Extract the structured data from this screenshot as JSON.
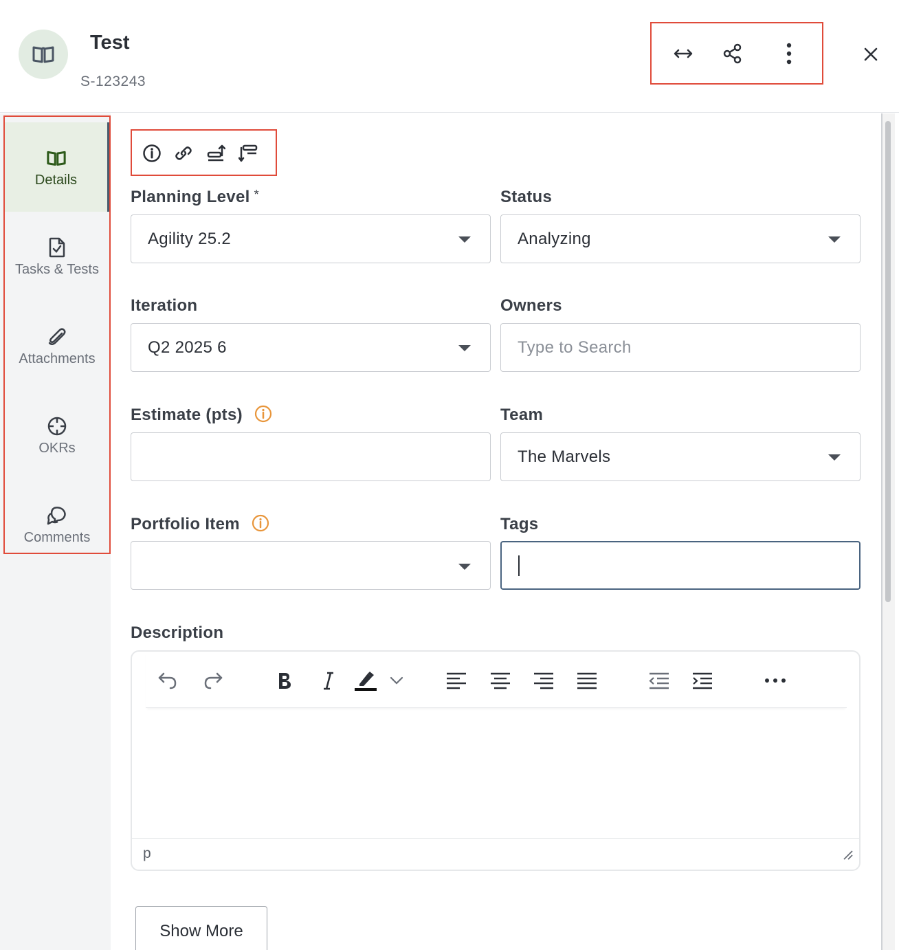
{
  "header": {
    "title": "Test",
    "id": "S-123243",
    "icon": "book-icon",
    "actions": [
      "expand-width-icon",
      "share-icon",
      "more-vertical-icon"
    ],
    "close_icon": "close-icon"
  },
  "sidebar": {
    "items": [
      {
        "label": "Details",
        "icon": "book-icon",
        "active": true
      },
      {
        "label": "Tasks & Tests",
        "icon": "task-file-icon",
        "active": false
      },
      {
        "label": "Attachments",
        "icon": "paperclip-icon",
        "active": false
      },
      {
        "label": "OKRs",
        "icon": "target-icon",
        "active": false
      },
      {
        "label": "Comments",
        "icon": "comments-icon",
        "active": false
      }
    ]
  },
  "quick_icons": [
    "info-icon",
    "link-icon",
    "move-up-icon",
    "move-down-icon"
  ],
  "form": {
    "planning_level": {
      "label": "Planning Level",
      "required_mark": "*",
      "value": "Agility 25.2"
    },
    "status": {
      "label": "Status",
      "value": "Analyzing"
    },
    "iteration": {
      "label": "Iteration",
      "value": "Q2 2025 6"
    },
    "owners": {
      "label": "Owners",
      "placeholder": "Type to Search"
    },
    "estimate": {
      "label": "Estimate (pts)",
      "value": ""
    },
    "team": {
      "label": "Team",
      "value": "The Marvels"
    },
    "portfolio_item": {
      "label": "Portfolio Item",
      "value": ""
    },
    "tags": {
      "label": "Tags",
      "value": ""
    },
    "description": {
      "label": "Description",
      "status_path": "p",
      "toolbar": [
        "undo-icon",
        "redo-icon",
        "bold-icon",
        "italic-icon",
        "highlight-icon",
        "chevron-down-icon",
        "align-left-icon",
        "align-center-icon",
        "align-right-icon",
        "align-justify-icon",
        "outdent-icon",
        "indent-icon",
        "more-horizontal-icon"
      ]
    }
  },
  "buttons": {
    "show_more": "Show More"
  },
  "colors": {
    "accent_red": "#e04b3a",
    "active_sidebar_bg": "#e8efe4",
    "info_orange": "#e8953a",
    "focus_border": "#4a6480"
  }
}
